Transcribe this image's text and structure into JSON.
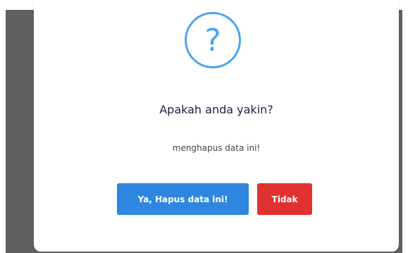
{
  "dialog": {
    "icon": "question-mark-icon",
    "icon_glyph": "?",
    "title": "Apakah anda yakin?",
    "message": "menghapus data ini!",
    "confirm_label": "Ya, Hapus data ini!",
    "cancel_label": "Tidak"
  },
  "colors": {
    "backdrop": "#5f5f5f",
    "icon": "#4aa3f2",
    "confirm_button": "#2e86de",
    "cancel_button": "#e03131"
  }
}
